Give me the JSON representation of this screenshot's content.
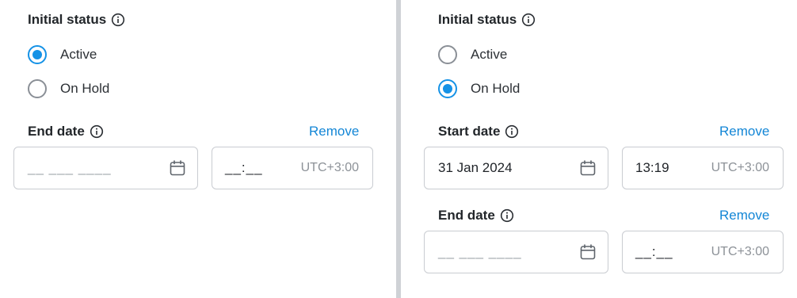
{
  "left_panel": {
    "initial_status": {
      "heading": "Initial status",
      "options": [
        {
          "label": "Active",
          "selected": true
        },
        {
          "label": "On Hold",
          "selected": false
        }
      ]
    },
    "end_date": {
      "heading": "End date",
      "remove_label": "Remove",
      "date_placeholder": "__ ___ ____",
      "time_placeholder": "__:__",
      "timezone": "UTC+3:00"
    }
  },
  "right_panel": {
    "initial_status": {
      "heading": "Initial status",
      "options": [
        {
          "label": "Active",
          "selected": false
        },
        {
          "label": "On Hold",
          "selected": true
        }
      ]
    },
    "start_date": {
      "heading": "Start date",
      "remove_label": "Remove",
      "date_value": "31 Jan 2024",
      "time_value": "13:19",
      "timezone": "UTC+3:00"
    },
    "end_date": {
      "heading": "End date",
      "remove_label": "Remove",
      "date_placeholder": "__ ___ ____",
      "time_placeholder": "__:__",
      "timezone": "UTC+3:00"
    }
  },
  "colors": {
    "accent": "#1592e6",
    "link": "#1386d6",
    "border": "#c9ccd1",
    "divider": "#cfd2d6",
    "placeholder": "#9aa0a6"
  },
  "icons": [
    "info-icon",
    "calendar-icon"
  ]
}
